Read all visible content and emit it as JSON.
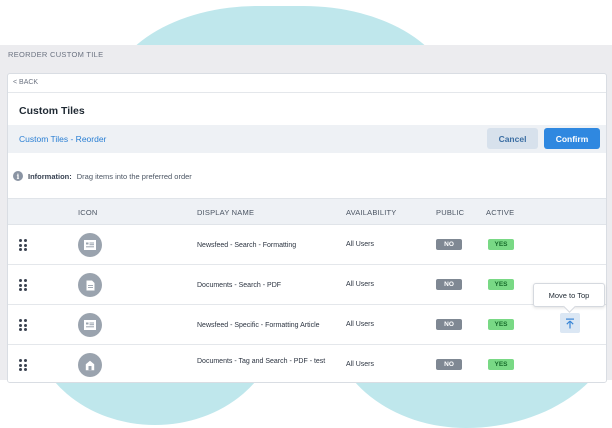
{
  "window": {
    "title": "REORDER CUSTOM TILE"
  },
  "nav": {
    "back_label": "< BACK"
  },
  "page": {
    "title": "Custom Tiles"
  },
  "subheader": {
    "breadcrumb": "Custom Tiles - Reorder",
    "cancel_label": "Cancel",
    "confirm_label": "Confirm"
  },
  "info": {
    "icon": "info-icon",
    "label": "Information:",
    "text": "Drag items into the preferred order"
  },
  "table": {
    "columns": [
      "ICON",
      "DISPLAY NAME",
      "AVAILABILITY",
      "PUBLIC",
      "ACTIVE"
    ],
    "rows": [
      {
        "icon": "newsfeed-icon",
        "name": "Newsfeed - Search - Formatting",
        "availability": "All Users",
        "public": "NO",
        "active": "YES"
      },
      {
        "icon": "document-icon",
        "name": "Documents - Search - PDF",
        "availability": "All Users",
        "public": "NO",
        "active": "YES"
      },
      {
        "icon": "newsfeed-icon",
        "name": "Newsfeed - Specific - Formatting Article",
        "availability": "All Users",
        "public": "NO",
        "active": "YES"
      },
      {
        "icon": "document-tag-icon",
        "name": "Documents - Tag and Search - PDF - test",
        "availability": "All Users",
        "public": "NO",
        "active": "YES"
      }
    ]
  },
  "tooltip": {
    "label": "Move to Top",
    "icon": "move-to-top-icon"
  },
  "colors": {
    "accent": "#2f88e0",
    "link": "#2a7fd4",
    "badge_no": "#7f8893",
    "badge_yes": "#79d985",
    "background_blob": "#bfe7ec"
  }
}
